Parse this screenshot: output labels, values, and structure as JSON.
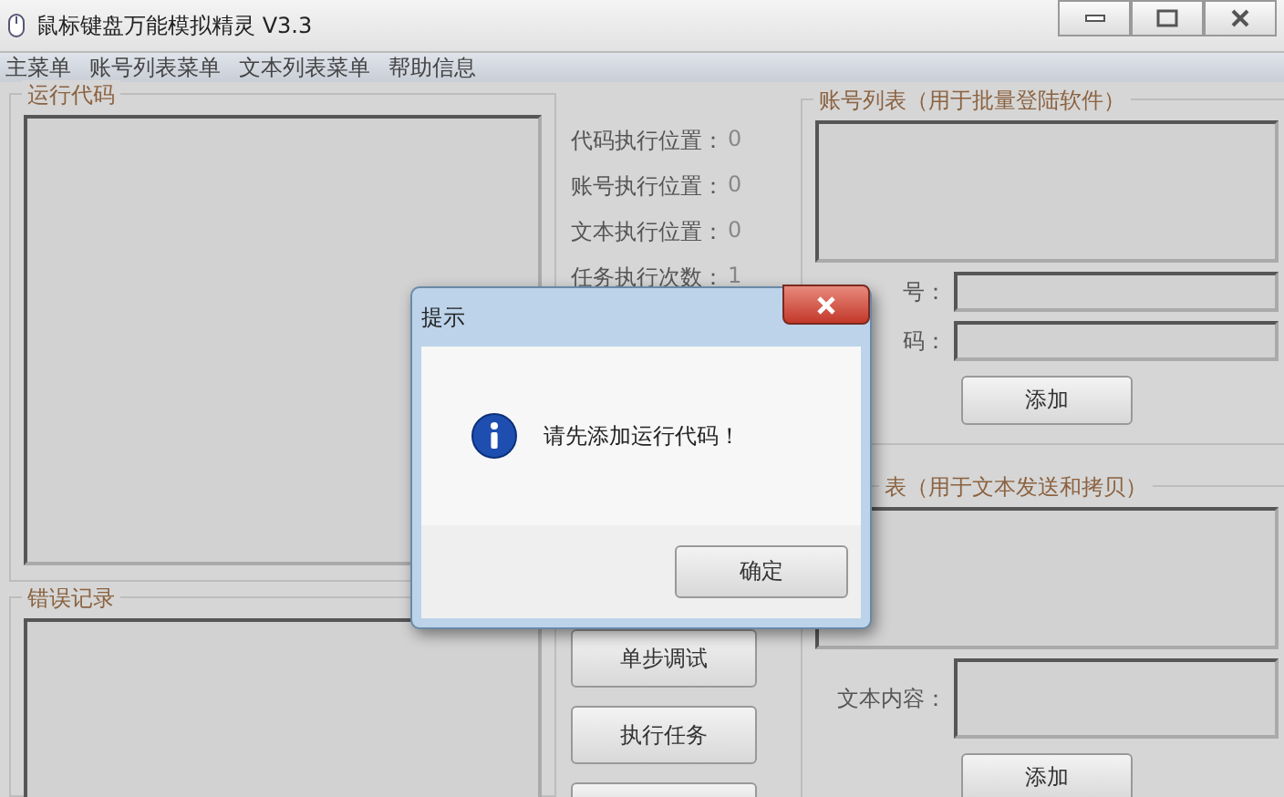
{
  "window": {
    "title": "鼠标键盘万能模拟精灵 V3.3"
  },
  "menu": [
    "主菜单",
    "账号列表菜单",
    "文本列表菜单",
    "帮助信息"
  ],
  "code_panel": {
    "title": "运行代码"
  },
  "error_panel": {
    "title": "错误记录"
  },
  "status": [
    {
      "label": "代码执行位置：",
      "value": "0"
    },
    {
      "label": "账号执行位置：",
      "value": "0"
    },
    {
      "label": "文本执行位置：",
      "value": "0"
    },
    {
      "label": "任务执行次数：",
      "value": "1"
    }
  ],
  "action_buttons": [
    "单步调试",
    "执行任务"
  ],
  "account_list": {
    "title": "账号列表（用于批量登陆软件）",
    "fields": [
      {
        "label": "号："
      },
      {
        "label": "码："
      }
    ],
    "button": "添加"
  },
  "text_list": {
    "title": "表（用于文本发送和拷贝）",
    "fields": [
      {
        "label": "文本内容："
      }
    ],
    "button": "添加"
  },
  "dialog": {
    "title": "提示",
    "message": "请先添加运行代码！",
    "button": "确定"
  }
}
